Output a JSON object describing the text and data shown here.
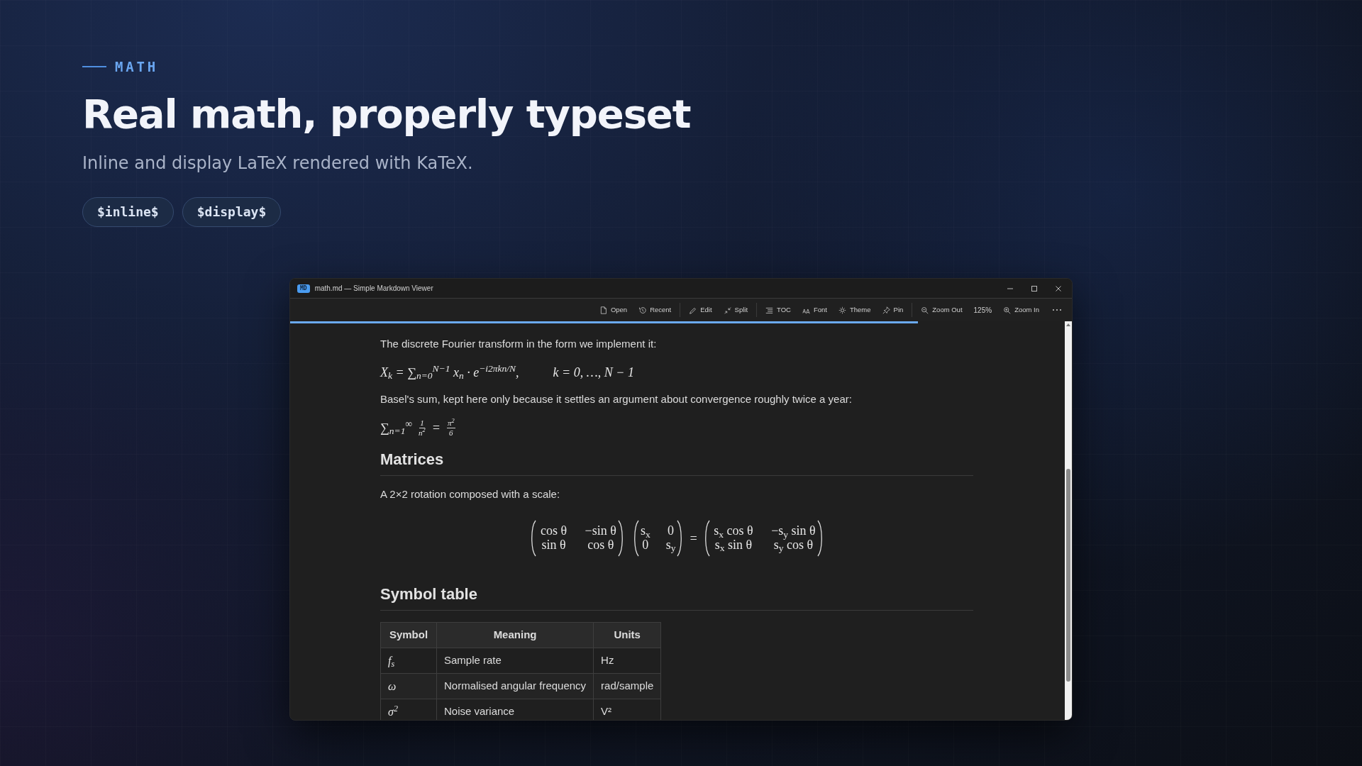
{
  "hero": {
    "eyebrow": "MATH",
    "title": "Real math, properly typeset",
    "subtitle": "Inline and display LaTeX rendered with KaTeX.",
    "chips": [
      "$inline$",
      "$display$"
    ]
  },
  "window": {
    "badge": "MD",
    "title": "math.md — Simple Markdown Viewer",
    "toolbar": [
      [
        {
          "label": "Open"
        },
        {
          "label": "Recent"
        }
      ],
      [
        {
          "label": "Edit"
        },
        {
          "label": "Split"
        }
      ],
      [
        {
          "label": "TOC"
        },
        {
          "label": "Font"
        },
        {
          "label": "Theme"
        },
        {
          "label": "Pin"
        }
      ],
      [
        {
          "label": "Zoom Out"
        },
        {
          "label": "125%",
          "kind": "readout"
        },
        {
          "label": "Zoom In"
        }
      ]
    ],
    "reading_progress": {
      "level": 0.81
    },
    "document": [
      {
        "kind": "paragraph",
        "text": "The discrete Fourier transform in the form we implement it:"
      },
      {
        "kind": "math",
        "tokens": [
          {
            "kind": "text",
            "text": "X$_{k}$ = ∑$_{n=0}$$^{N−1}$ x$_{n}$ · e$^{−i2πkn/N}$,"
          },
          {
            "kind": "gap"
          },
          {
            "kind": "text",
            "text": "k = 0, …, N − 1"
          }
        ]
      },
      {
        "kind": "paragraph",
        "text": "Basel's sum, kept here only because it settles an argument about convergence roughly twice a year:"
      },
      {
        "kind": "math",
        "tokens": [
          {
            "kind": "text",
            "text": "∑$_{n=1}$$^{∞}$"
          },
          {
            "kind": "frac",
            "num": "1",
            "den": "n$^{2}$"
          },
          {
            "kind": "text",
            "text": "="
          },
          {
            "kind": "frac",
            "num": "π$^{2}$",
            "den": "6"
          }
        ]
      },
      {
        "kind": "heading",
        "text": "Matrices"
      },
      {
        "kind": "paragraph",
        "text": "A 2×2 rotation composed with a scale:"
      },
      {
        "kind": "display",
        "tokens": [
          {
            "kind": "matrix",
            "rows": [
              [
                "cos θ",
                "−sin θ"
              ],
              [
                "sin θ",
                "cos θ"
              ]
            ]
          },
          {
            "kind": "matrix",
            "rows": [
              [
                "s$_{x}$",
                "0"
              ],
              [
                "0",
                "s$_{y}$"
              ]
            ]
          },
          {
            "kind": "text",
            "text": "="
          },
          {
            "kind": "matrix",
            "rows": [
              [
                "s$_{x}$ cos θ",
                "−s$_{y}$ sin θ"
              ],
              [
                "s$_{x}$ sin θ",
                "s$_{y}$ cos θ"
              ]
            ]
          }
        ]
      },
      {
        "kind": "heading",
        "text": "Symbol table"
      },
      {
        "kind": "table",
        "columns": [
          "Symbol",
          "Meaning",
          "Units"
        ],
        "rows": [
          [
            "f$_{s}$",
            "Sample rate",
            "Hz"
          ],
          [
            "ω",
            "Normalised angular frequency",
            "rad/sample"
          ],
          [
            "σ$^{2}$",
            "Noise variance",
            "V²"
          ]
        ]
      }
    ]
  }
}
